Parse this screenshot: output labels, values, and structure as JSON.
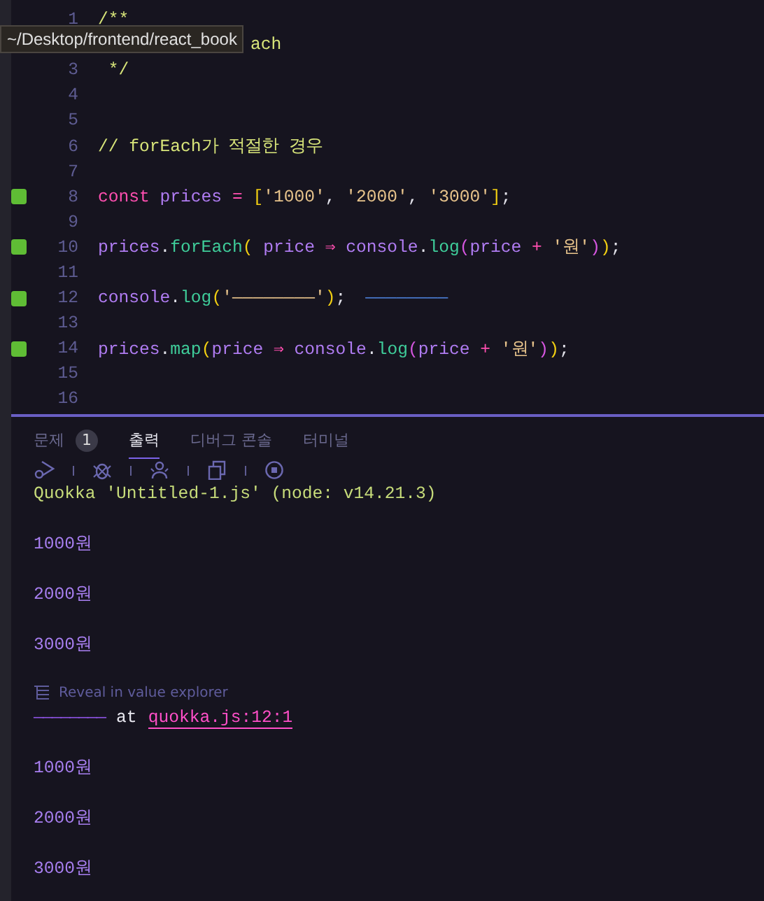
{
  "tooltip": {
    "text": "~/Desktop/frontend/react_book"
  },
  "editor": {
    "lines": [
      {
        "number": "1",
        "covered": false,
        "tokens": [
          {
            "t": "/**",
            "kind": "comment"
          }
        ]
      },
      {
        "covered": false,
        "kind": "under_tooltip",
        "tokens": [
          {
            "t": "ach",
            "kind": "comment"
          }
        ]
      },
      {
        "number": "3",
        "covered": false,
        "tokens": [
          {
            "t": " */",
            "kind": "comment"
          }
        ]
      },
      {
        "number": "4",
        "covered": false
      },
      {
        "number": "5",
        "covered": false
      },
      {
        "number": "6",
        "covered": false,
        "tokens": [
          {
            "t": "// forEach가 적절한 경우",
            "kind": "comment"
          }
        ]
      },
      {
        "number": "7",
        "covered": false
      },
      {
        "number": "8",
        "covered": true,
        "tokens": [
          {
            "t": "const",
            "kind": "kw"
          },
          {
            "t": " prices ",
            "kind": "var"
          },
          {
            "t": "= ",
            "kind": "op"
          },
          {
            "t": "[",
            "kind": "b1"
          },
          {
            "t": "'1000'",
            "kind": "str"
          },
          {
            "t": ", ",
            "kind": "punc"
          },
          {
            "t": "'2000'",
            "kind": "str"
          },
          {
            "t": ", ",
            "kind": "punc"
          },
          {
            "t": "'3000'",
            "kind": "str"
          },
          {
            "t": "]",
            "kind": "b1"
          },
          {
            "t": ";",
            "kind": "punc"
          }
        ]
      },
      {
        "number": "9",
        "covered": false
      },
      {
        "number": "10",
        "covered": true,
        "tokens": [
          {
            "t": "prices",
            "kind": "var"
          },
          {
            "t": ".",
            "kind": "punc"
          },
          {
            "t": "forEach",
            "kind": "fn"
          },
          {
            "t": "(",
            "kind": "b1"
          },
          {
            "t": " price ",
            "kind": "var"
          },
          {
            "t": "⇒",
            "kind": "op"
          },
          {
            "t": " console",
            "kind": "var"
          },
          {
            "t": ".",
            "kind": "punc"
          },
          {
            "t": "log",
            "kind": "fn"
          },
          {
            "t": "(",
            "kind": "b2"
          },
          {
            "t": "price ",
            "kind": "var"
          },
          {
            "t": "+ ",
            "kind": "op"
          },
          {
            "t": "'원'",
            "kind": "str"
          },
          {
            "t": ")",
            "kind": "b2"
          },
          {
            "t": ")",
            "kind": "b1"
          },
          {
            "t": ";",
            "kind": "punc"
          }
        ]
      },
      {
        "number": "11",
        "covered": false
      },
      {
        "number": "12",
        "covered": true,
        "tokens": [
          {
            "t": "console",
            "kind": "var"
          },
          {
            "t": ".",
            "kind": "punc"
          },
          {
            "t": "log",
            "kind": "fn"
          },
          {
            "t": "(",
            "kind": "b1"
          },
          {
            "t": "'————————'",
            "kind": "str"
          },
          {
            "t": ")",
            "kind": "b1"
          },
          {
            "t": ";",
            "kind": "punc"
          },
          {
            "t": "————————",
            "kind": "inline"
          }
        ]
      },
      {
        "number": "13",
        "covered": false
      },
      {
        "number": "14",
        "covered": true,
        "tokens": [
          {
            "t": "prices",
            "kind": "var"
          },
          {
            "t": ".",
            "kind": "punc"
          },
          {
            "t": "map",
            "kind": "fn"
          },
          {
            "t": "(",
            "kind": "b1"
          },
          {
            "t": "price ",
            "kind": "var"
          },
          {
            "t": "⇒",
            "kind": "op"
          },
          {
            "t": " console",
            "kind": "var"
          },
          {
            "t": ".",
            "kind": "punc"
          },
          {
            "t": "log",
            "kind": "fn"
          },
          {
            "t": "(",
            "kind": "b2"
          },
          {
            "t": "price ",
            "kind": "var"
          },
          {
            "t": "+ ",
            "kind": "op"
          },
          {
            "t": "'원'",
            "kind": "str"
          },
          {
            "t": ")",
            "kind": "b2"
          },
          {
            "t": ")",
            "kind": "b1"
          },
          {
            "t": ";",
            "kind": "punc"
          }
        ]
      },
      {
        "number": "15",
        "covered": false
      },
      {
        "number": "16",
        "covered": false
      }
    ]
  },
  "panel": {
    "tabs": [
      {
        "label": "문제",
        "selected": false,
        "badge": "1"
      },
      {
        "label": "출력",
        "selected": true
      },
      {
        "label": "디버그 콘솔",
        "selected": false
      },
      {
        "label": "터미널",
        "selected": false
      }
    ],
    "output": [
      {
        "kind": "header",
        "text": "Quokka 'Untitled-1.js' (node: v14.21.3)"
      },
      {
        "kind": "value",
        "text": "1000원"
      },
      {
        "kind": "value",
        "text": "2000원"
      },
      {
        "kind": "value",
        "text": "3000원"
      },
      {
        "kind": "hint",
        "text": "Reveal in value explorer"
      },
      {
        "kind": "trace",
        "value": "————————",
        "text": "at",
        "link": "quokka.js:12:1"
      },
      {
        "kind": "value",
        "text": "1000원"
      },
      {
        "kind": "value",
        "text": "2000원"
      },
      {
        "kind": "value",
        "text": "3000원"
      }
    ]
  }
}
